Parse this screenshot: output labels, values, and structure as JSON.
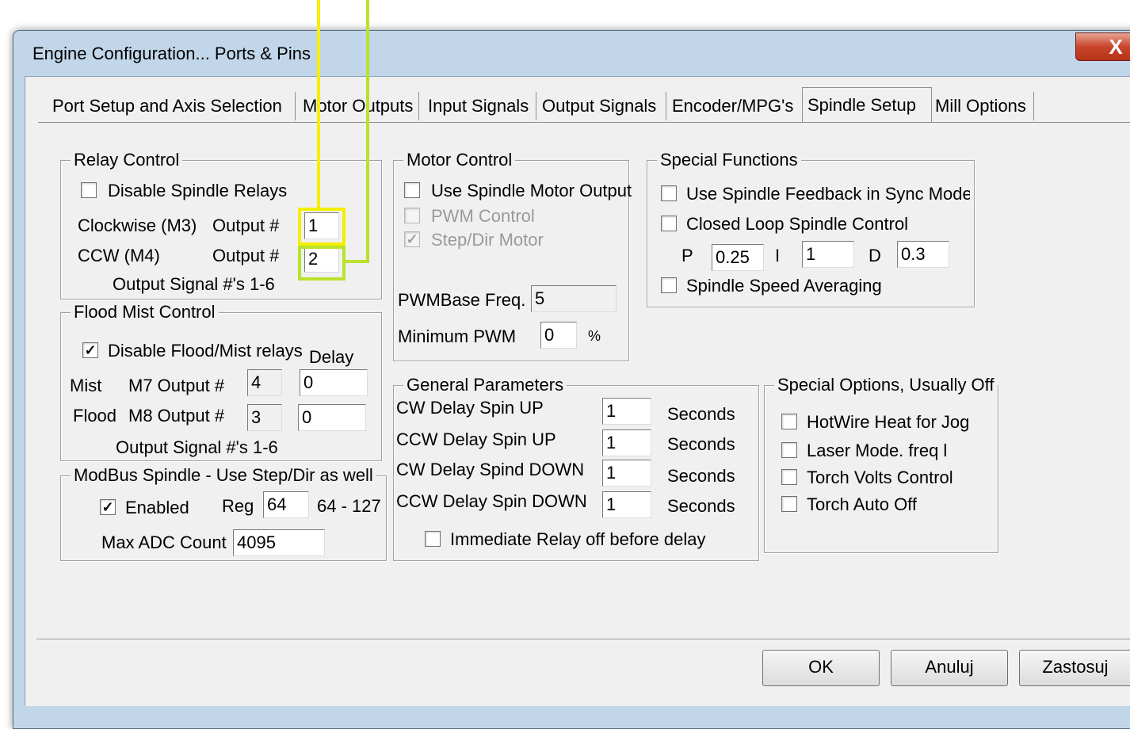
{
  "window": {
    "title": "Engine Configuration... Ports & Pins",
    "close": "X"
  },
  "tabs": [
    {
      "label": "Port Setup and Axis Selection"
    },
    {
      "label": "Motor Outputs"
    },
    {
      "label": "Input Signals"
    },
    {
      "label": "Output Signals"
    },
    {
      "label": "Encoder/MPG's"
    },
    {
      "label": "Spindle Setup"
    },
    {
      "label": "Mill Options"
    }
  ],
  "relay": {
    "legend": "Relay Control",
    "disable_label": "Disable Spindle Relays",
    "cw_label": "Clockwise (M3)",
    "ccw_label": "CCW (M4)",
    "output_label": "Output #",
    "cw_value": "1",
    "ccw_value": "2",
    "note": "Output Signal #'s 1-6"
  },
  "flood": {
    "legend": "Flood Mist Control",
    "disable_label": "Disable Flood/Mist relays",
    "delay_label": "Delay",
    "mist_label": "Mist",
    "m7_label": "M7 Output #",
    "flood_label": "Flood",
    "m8_label": "M8 Output #",
    "m7_value": "4",
    "m7_delay": "0",
    "m8_value": "3",
    "m8_delay": "0",
    "note": "Output Signal #'s 1-6",
    "check": "✓"
  },
  "modbus": {
    "legend": "ModBus Spindle - Use Step/Dir as well",
    "enabled_label": "Enabled",
    "reg_label": "Reg",
    "reg_value": "64",
    "range": "64 - 127",
    "max_label": "Max ADC Count",
    "max_value": "4095",
    "check": "✓"
  },
  "motor": {
    "legend": "Motor Control",
    "use_output": "Use Spindle Motor Output",
    "pwm_control": "PWM Control",
    "stepdir": "Step/Dir Motor",
    "pwm_base_label": "PWMBase Freq.",
    "pwm_base_value": "5",
    "min_pwm_label": "Minimum PWM",
    "min_pwm_value": "0",
    "percent": "%",
    "check": "✓"
  },
  "special": {
    "legend": "Special Functions",
    "feedback": "Use Spindle Feedback in Sync Modes",
    "closed_loop": "Closed Loop Spindle Control",
    "p_label": "P",
    "p_value": "0.25",
    "i_label": "I",
    "i_value": "1",
    "d_label": "D",
    "d_value": "0.3",
    "averaging": "Spindle Speed Averaging"
  },
  "general": {
    "legend": "General Parameters",
    "rows": [
      {
        "label": "CW Delay Spin UP",
        "value": "1",
        "unit": "Seconds"
      },
      {
        "label": "CCW Delay Spin UP",
        "value": "1",
        "unit": "Seconds"
      },
      {
        "label": "CW Delay Spind DOWN",
        "value": "1",
        "unit": "Seconds"
      },
      {
        "label": "CCW Delay Spin DOWN",
        "value": "1",
        "unit": "Seconds"
      }
    ],
    "immediate": "Immediate Relay off before delay"
  },
  "options": {
    "legend": "Special Options, Usually Off",
    "items": [
      {
        "label": "HotWire Heat for Jog"
      },
      {
        "label": "Laser Mode. freq l"
      },
      {
        "label": "Torch Volts Control"
      },
      {
        "label": "Torch Auto Off"
      }
    ]
  },
  "buttons": {
    "ok": "OK",
    "cancel": "Anuluj",
    "apply": "Zastosuj"
  },
  "colors": {
    "highlight_yellow": "#f4ef00",
    "highlight_green": "#b9e22b",
    "close_red": "#c9452b"
  }
}
